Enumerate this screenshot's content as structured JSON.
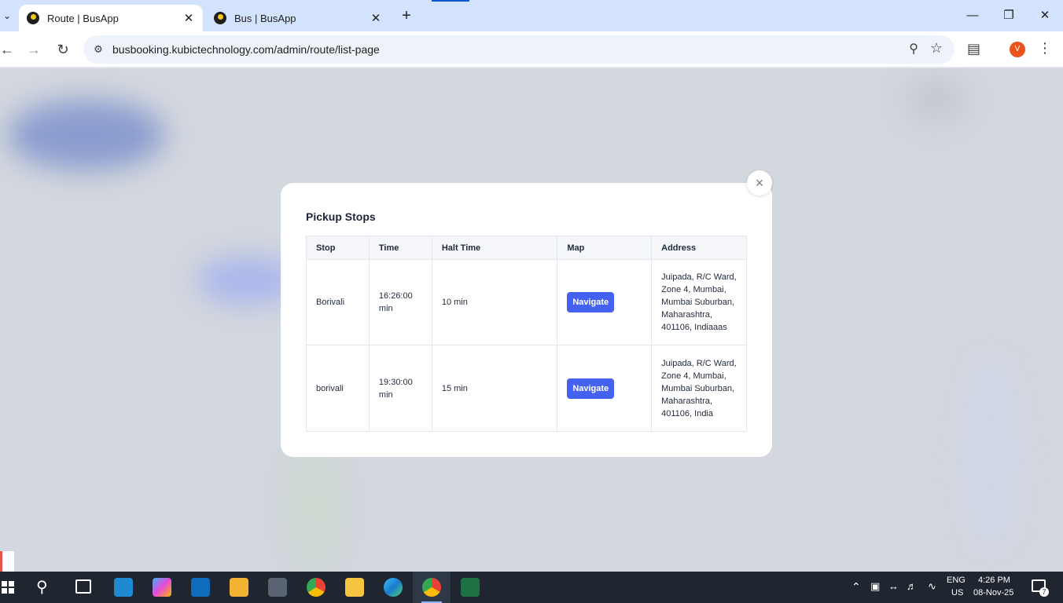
{
  "browser": {
    "tabs": [
      {
        "title": "Route | BusApp",
        "active": true
      },
      {
        "title": "Bus | BusApp",
        "active": false
      }
    ],
    "new_tab_symbol": "+",
    "url": "busbooking.kubictechnology.com/admin/route/list-page",
    "profile_initial": "V"
  },
  "modal": {
    "title": "Pickup Stops",
    "columns": [
      "Stop",
      "Time",
      "Halt Time",
      "Map",
      "Address"
    ],
    "rows": [
      {
        "stop": "Borivali",
        "time": "16:26:00 min",
        "halt": "10 min",
        "map_label": "Navigate",
        "address": "Juipada, R/C Ward, Zone 4, Mumbai, Mumbai Suburban, Maharashtra, 401106, Indiaaas"
      },
      {
        "stop": "borivali",
        "time": "19:30:00 min",
        "halt": "15 min",
        "map_label": "Navigate",
        "address": "Juipada, R/C Ward, Zone 4, Mumbai, Mumbai Suburban, Maharashtra, 401106, India"
      }
    ],
    "close_symbol": "×"
  },
  "taskbar": {
    "language": "ENG",
    "region": "US",
    "time": "4:26 PM",
    "date": "08-Nov-25",
    "notification_count": "7"
  },
  "colors": {
    "accent": "#4461f2",
    "tabbar": "#d3e3fd",
    "taskbar": "#1f2630"
  }
}
